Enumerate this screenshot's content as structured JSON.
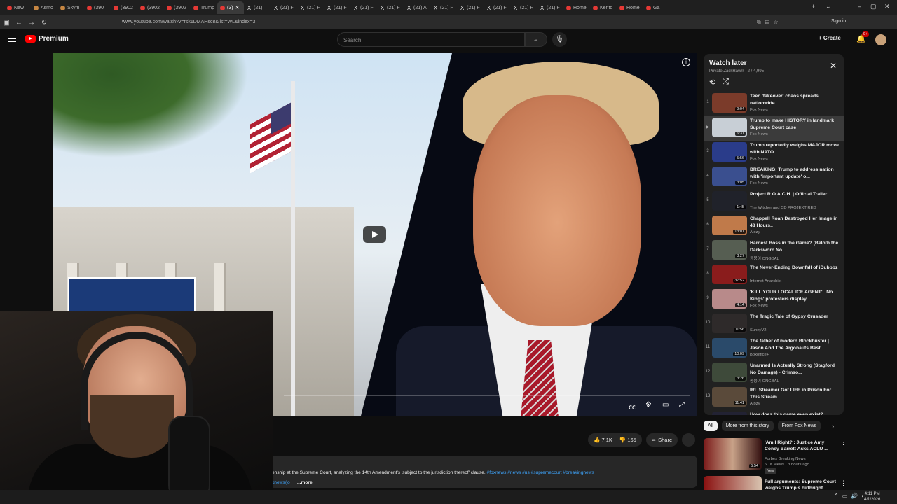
{
  "browser": {
    "tabs": [
      {
        "label": "New"
      },
      {
        "label": "Asmo"
      },
      {
        "label": "Skym"
      },
      {
        "label": "(390"
      },
      {
        "label": "(3902"
      },
      {
        "label": "(3902"
      },
      {
        "label": "(3902"
      },
      {
        "label": "Trump"
      },
      {
        "label": "(3)"
      },
      {
        "label": "(21)"
      },
      {
        "label": "(21) F"
      },
      {
        "label": "(21) F"
      },
      {
        "label": "(21) F"
      },
      {
        "label": "(21) F"
      },
      {
        "label": "(21) F"
      },
      {
        "label": "(21) A"
      },
      {
        "label": "(21) F"
      },
      {
        "label": "(21) F"
      },
      {
        "label": "(21) F"
      },
      {
        "label": "(21) R"
      },
      {
        "label": "(21) F"
      },
      {
        "label": "Home"
      },
      {
        "label": "Kento"
      },
      {
        "label": "Home"
      },
      {
        "label": "Ga"
      }
    ],
    "url": "www.youtube.com/watch?v=rsk1DMAHsc8&list=WL&index=3",
    "sign_in": "Sign in"
  },
  "youtube": {
    "logo_text": "Premium",
    "search_placeholder": "Search",
    "create_label": "Create",
    "notif_badge": "9+"
  },
  "watch_later": {
    "title": "Watch later",
    "subtitle": "Private ZackRawrr · 2 / 4,995",
    "items": [
      {
        "num": "1",
        "title": "Teen 'takeover' chaos spreads nationwide...",
        "channel": "Fox News",
        "duration": "9:04"
      },
      {
        "num": "▶",
        "title": "Trump to make HISTORY in landmark Supreme Court case",
        "channel": "Fox News",
        "duration": "6:31"
      },
      {
        "num": "3",
        "title": "Trump reportedly weighs MAJOR move with NATO",
        "channel": "Fox News",
        "duration": "5:56"
      },
      {
        "num": "4",
        "title": "BREAKING: Trump to address nation with 'important update' o...",
        "channel": "Fox News",
        "duration": "3:05"
      },
      {
        "num": "5",
        "title": "Project R.O.A.C.H. | Official Trailer",
        "channel": "The Witcher and CD PROJEKT RED",
        "duration": "1:45"
      },
      {
        "num": "6",
        "title": "Chappell Roan Destroyed Her Image in 48 Hours..",
        "channel": "Atozy",
        "duration": "13:01"
      },
      {
        "num": "7",
        "title": "Hardest Boss in the Game? (Beloth the Darksworn No...",
        "channel": "몽뭉이 ONGBAL",
        "duration": "3:27"
      },
      {
        "num": "8",
        "title": "The Never-Ending Downfall of iDubbbz",
        "channel": "Internet Anarchist",
        "duration": "37:52"
      },
      {
        "num": "9",
        "title": "'KILL YOUR LOCAL ICE AGENT': 'No Kings' protesters display...",
        "channel": "Fox News",
        "duration": "4:14"
      },
      {
        "num": "10",
        "title": "The Tragic Tale of Gypsy Crusader",
        "channel": "SunnyV2",
        "duration": "11:56"
      },
      {
        "num": "11",
        "title": "The father of modern Blockbuster | Jason And The Argonauts Best...",
        "channel": "Boxoffice+",
        "duration": "10:09"
      },
      {
        "num": "12",
        "title": "Unarmed Is Actually Strong (Stagford No Damage) - Crimso...",
        "channel": "몽뭉이 ONGBAL",
        "duration": "3:26"
      },
      {
        "num": "13",
        "title": "IRL Streamer Got LIFE in Prison For This Stream..",
        "channel": "Atozy",
        "duration": "11:41"
      },
      {
        "num": "",
        "title": "How does this game even exist?",
        "channel": "",
        "duration": ""
      }
    ]
  },
  "chips": [
    "All",
    "More from this story",
    "From Fox News"
  ],
  "recommended": [
    {
      "title": "'Am I Right?': Justice Amy Coney Barrett Asks ACLU ...",
      "channel": "Forbes Breaking News",
      "meta": "6.1K views · 3 hours ago",
      "badge": "New",
      "duration": "5:54"
    },
    {
      "title": "Full arguments: Supreme Court weighs Trump's birthright..."
    }
  ],
  "actions": {
    "likes": "7.1K",
    "dislikes": "165",
    "share": "Share"
  },
  "description": {
    "text": "enship at the Supreme Court, analyzing the 14th Amendment's 'subject to the jurisdiction thereof' clause.",
    "tags": "#foxnews #news #us #supremecourt #breakingnews",
    "link": "xnews/jo",
    "more": "...more"
  },
  "taskbar": {
    "time": "4:11 PM",
    "date": "4/1/2026"
  }
}
